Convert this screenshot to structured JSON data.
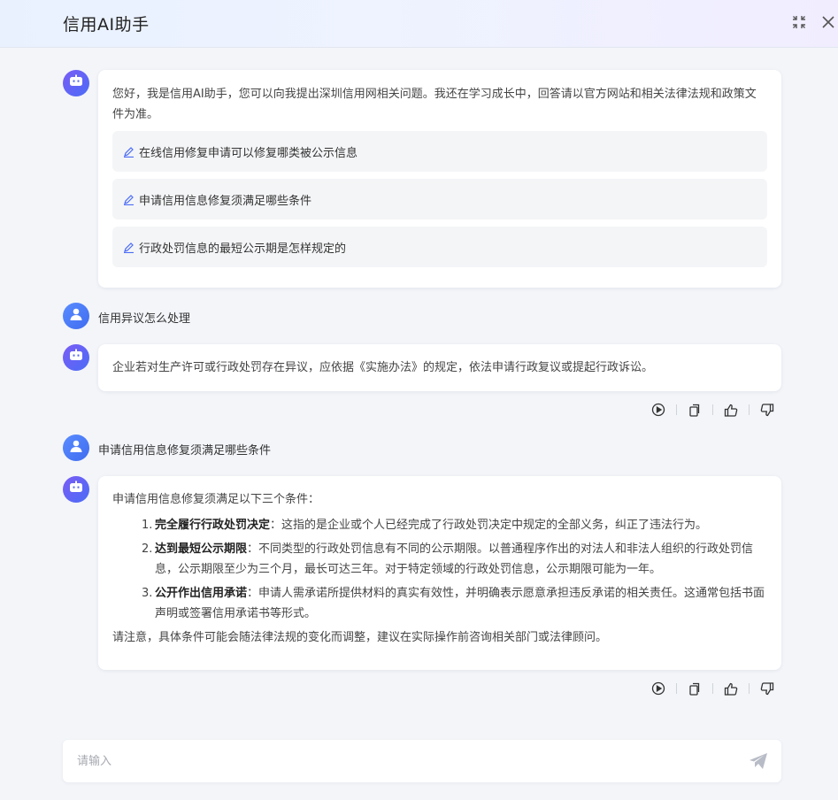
{
  "header": {
    "title": "信用AI助手"
  },
  "welcome": {
    "text": "您好，我是信用AI助手，您可以向我提出深圳信用网相关问题。我还在学习成长中，回答请以官方网站和相关法律法规和政策文件为准。",
    "suggestions": [
      "在线信用修复申请可以修复哪类被公示信息",
      "申请信用信息修复须满足哪些条件",
      "行政处罚信息的最短公示期是怎样规定的"
    ]
  },
  "conversation": [
    {
      "question": "信用异议怎么处理",
      "answer": "企业若对生产许可或行政处罚存在异议，应依据《实施办法》的规定，依法申请行政复议或提起行政诉讼。"
    },
    {
      "question": "申请信用信息修复须满足哪些条件",
      "answer_intro": "申请信用信息修复须满足以下三个条件：",
      "conditions": [
        {
          "num": "1.",
          "title": "完全履行行政处罚决定",
          "text": "：这指的是企业或个人已经完成了行政处罚决定中规定的全部义务，纠正了违法行为。"
        },
        {
          "num": "2.",
          "title": "达到最短公示期限",
          "text": "：不同类型的行政处罚信息有不同的公示期限。以普通程序作出的对法人和非法人组织的行政处罚信息，公示期限至少为三个月，最长可达三年。对于特定领域的行政处罚信息，公示期限可能为一年。"
        },
        {
          "num": "3.",
          "title": "公开作出信用承诺",
          "text": "：申请人需承诺所提供材料的真实有效性，并明确表示愿意承担违反承诺的相关责任。这通常包括书面声明或签署信用承诺书等形式。"
        }
      ],
      "answer_note": "请注意，具体条件可能会随法律法规的变化而调整，建议在实际操作前咨询相关部门或法律顾问。"
    }
  ],
  "input": {
    "placeholder": "请输入"
  },
  "icons": {
    "collapse": "collapse-icon",
    "close": "close-icon",
    "bot": "robot-icon",
    "user": "user-icon",
    "pen": "pen-icon",
    "play": "play-icon",
    "copy": "copy-icon",
    "like": "thumbs-up-icon",
    "dislike": "thumbs-down-icon",
    "send": "send-icon"
  },
  "colors": {
    "accent": "#4b6cf6",
    "bot_avatar": "#6a5ef5",
    "user_avatar": "#4f7cf8"
  }
}
